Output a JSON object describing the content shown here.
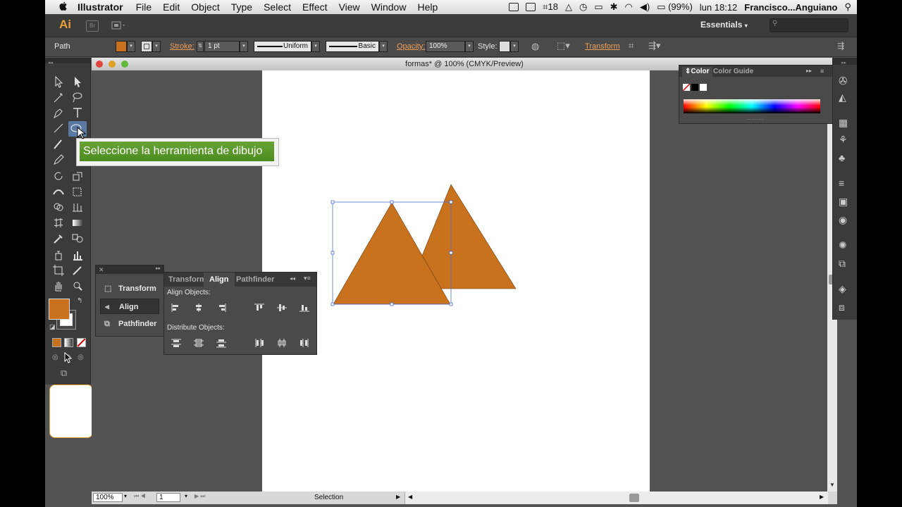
{
  "menubar": {
    "app_name": "Illustrator",
    "items": [
      "File",
      "Edit",
      "Object",
      "Type",
      "Select",
      "Effect",
      "View",
      "Window",
      "Help"
    ],
    "status_number": "18",
    "battery": "(99%)",
    "clock": "lun 18:12",
    "user": "Francisco...Anguiano"
  },
  "appbar": {
    "logo": "Ai",
    "br_label": "Br",
    "workspace": "Essentials"
  },
  "controlbar": {
    "selection_type": "Path",
    "stroke_label": "Stroke:",
    "stroke_value": "1 pt",
    "profile_uniform": "Uniform",
    "brush_basic": "Basic",
    "opacity_label": "Opacity:",
    "opacity_value": "100%",
    "style_label": "Style:",
    "transform_link": "Transform",
    "fill_color": "#c8721e"
  },
  "document": {
    "title": "formas* @ 100% (CMYK/Preview)",
    "zoom": "100%",
    "artboard_number": "1",
    "status_text": "Selection"
  },
  "tooltip": {
    "text": "Seleccione la herramienta de dibujo"
  },
  "collapsed_panels": {
    "items": [
      "Transform",
      "Align",
      "Pathfinder"
    ]
  },
  "align_panel": {
    "tabs": [
      "Transform",
      "Align",
      "Pathfinder"
    ],
    "active_tab": "Align",
    "align_objects_label": "Align Objects:",
    "distribute_objects_label": "Distribute Objects:"
  },
  "color_panel": {
    "tabs": [
      "Color",
      "Color Guide"
    ],
    "active_tab": "Color"
  },
  "shapes": {
    "fill": "#c8721e"
  }
}
